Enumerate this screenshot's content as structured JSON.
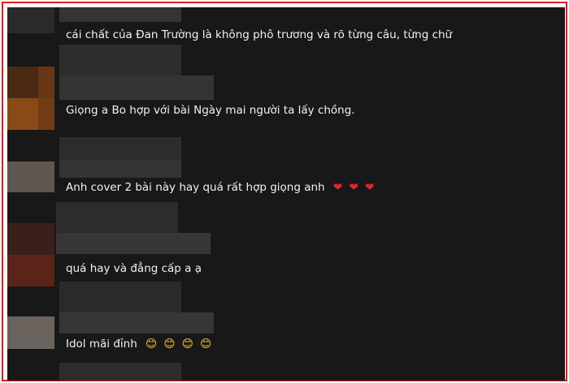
{
  "comments": [
    {
      "text": "cái chất của Đan Trường là không phô trương và rõ từng câu, từng chữ",
      "emojis": []
    },
    {
      "text": "Giọng a Bo hợp với bài Ngày mai người ta lấy chồng.",
      "emojis": []
    },
    {
      "text": "Anh cover 2 bài này hay quá rất hợp giọng anh",
      "emojis": [
        "❤",
        "❤",
        "❤"
      ]
    },
    {
      "text": "quá hay và đẳng cấp a ạ",
      "emojis": []
    },
    {
      "text": "Idol mãi đỉnh",
      "emojis": [
        "😊",
        "😊",
        "😊",
        "😊"
      ]
    }
  ],
  "colors": {
    "frame_border": "#e5151b",
    "background": "#181818",
    "text": "#f1f1f1",
    "heart": "#e0262b"
  },
  "icons": {
    "heart": "heart-icon",
    "smile": "smiling-face-icon"
  }
}
